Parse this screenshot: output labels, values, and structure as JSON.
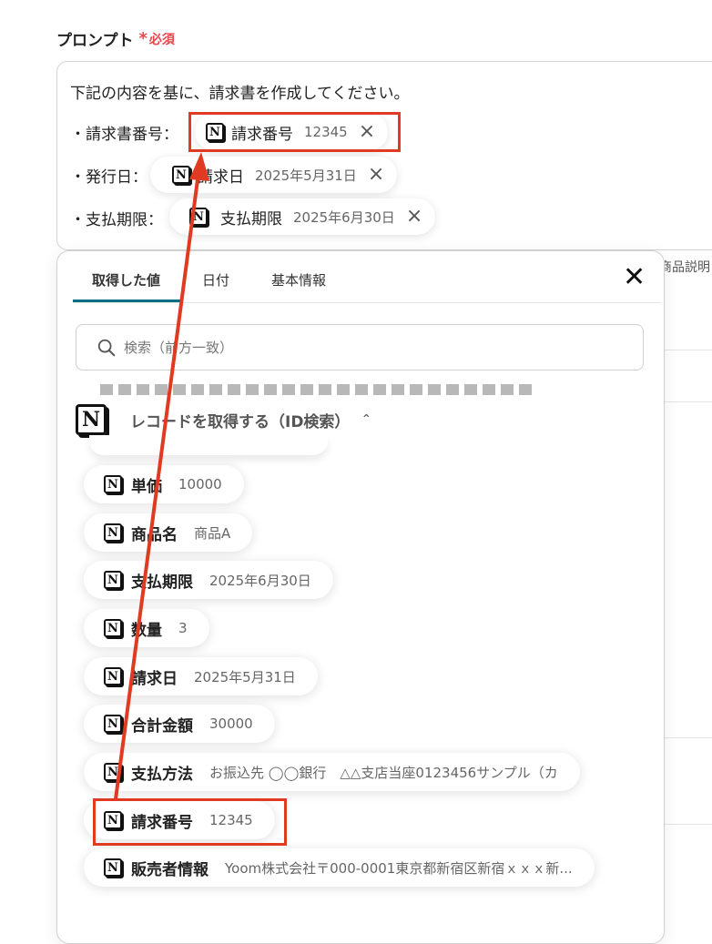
{
  "field": {
    "label": "プロンプト",
    "required_star": "*",
    "required_text": "必須"
  },
  "prompt": {
    "intro": "下記の内容を基に、請求書を作成してください。",
    "lines": [
      {
        "prefix": "・請求書番号：",
        "tag_label": "請求番号",
        "tag_value": "12345"
      },
      {
        "prefix": "・発行日：",
        "tag_label": "請求日",
        "tag_value": "2025年5月31日"
      },
      {
        "prefix": "・支払期限：",
        "tag_label": "支払期限",
        "tag_value": "2025年6月30日"
      }
    ],
    "right_cut_text": "商品説明"
  },
  "popup": {
    "tabs": [
      "取得した値",
      "日付",
      "基本情報"
    ],
    "active_tab": 0,
    "search_placeholder": "検索（前方一致）",
    "group_title": "レコードを取得する（ID検索）",
    "items": [
      {
        "label": "単価",
        "value": "10000"
      },
      {
        "label": "商品名",
        "value": "商品A"
      },
      {
        "label": "支払期限",
        "value": "2025年6月30日"
      },
      {
        "label": "数量",
        "value": "3"
      },
      {
        "label": "請求日",
        "value": "2025年5月31日"
      },
      {
        "label": "合計金額",
        "value": "30000"
      },
      {
        "label": "支払方法",
        "value": "お振込先 ◯◯銀行　△△支店当座0123456サンプル（カ"
      },
      {
        "label": "請求番号",
        "value": "12345"
      },
      {
        "label": "販売者情報",
        "value": "Yoom株式会社〒000-0001東京都新宿区新宿ｘｘｘ新..."
      }
    ]
  },
  "colors": {
    "highlight": "#e03a22",
    "required": "#e5484d",
    "tab_accent": "#0c6e84"
  },
  "icons": {
    "notion": "N",
    "close": "×",
    "search": "magnifier",
    "chevron": "^"
  }
}
